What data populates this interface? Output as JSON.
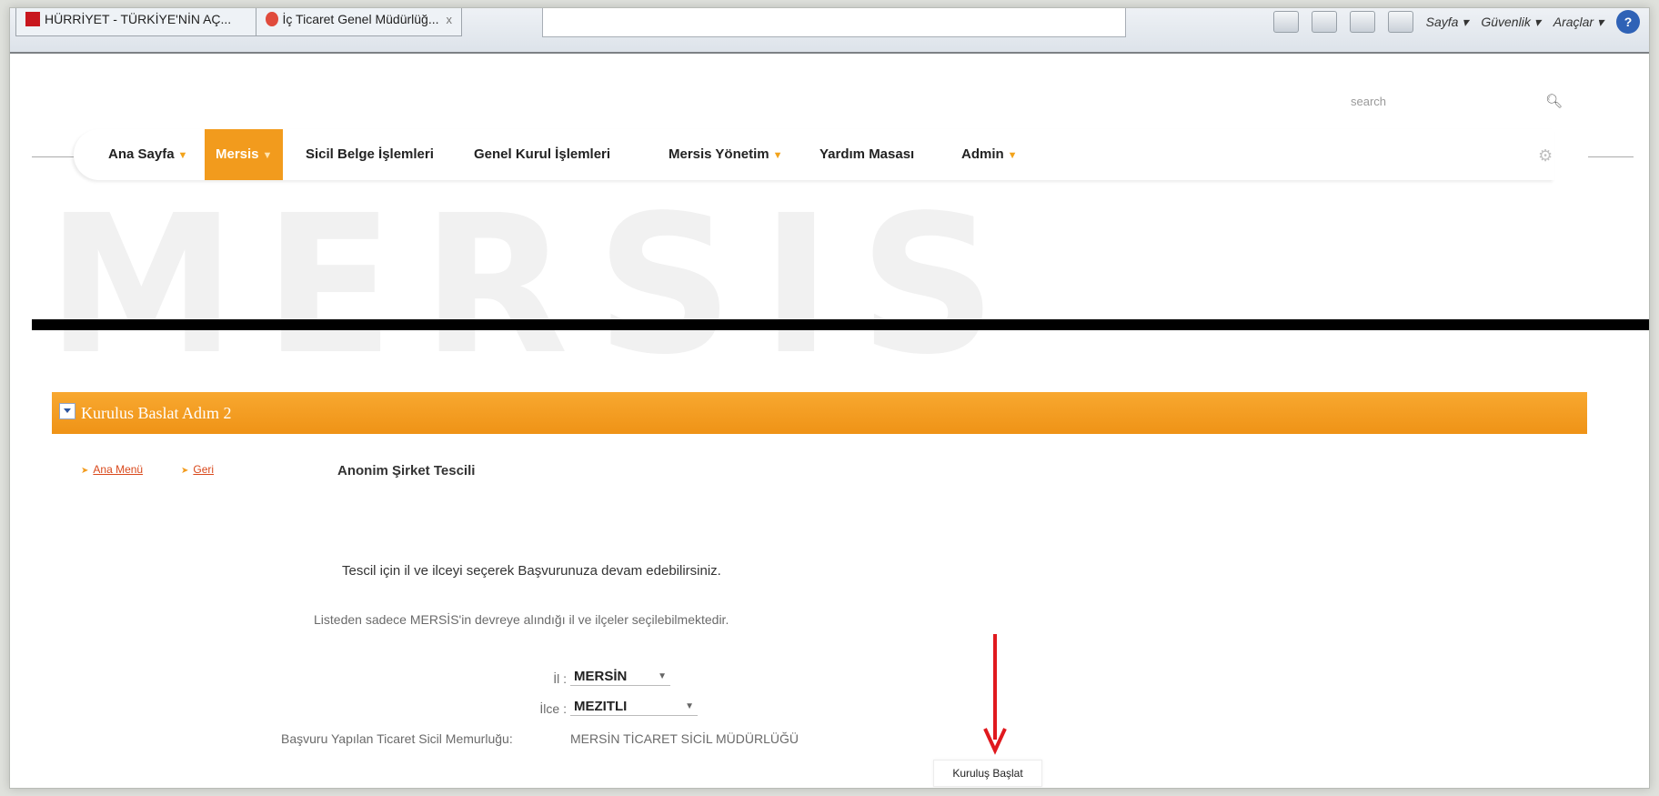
{
  "browser": {
    "tabs": [
      {
        "label": "HÜRRİYET - TÜRKİYE'NİN AÇ..."
      },
      {
        "label": "İç Ticaret Genel Müdürlüğ..."
      }
    ],
    "tools": [
      "Sayfa ▾",
      "Güvenlik ▾",
      "Araçlar ▾"
    ],
    "help_glyph": "?",
    "close_glyph": "x"
  },
  "header": {
    "search_placeholder": "search",
    "watermark": "MERSIS"
  },
  "nav": {
    "items": [
      {
        "label": "Ana Sayfa",
        "dropdown": true
      },
      {
        "label": "Mersis",
        "dropdown": true,
        "active": true
      },
      {
        "label": "Sicil Belge İşlemleri"
      },
      {
        "label": "Genel Kurul İşlemleri"
      },
      {
        "label": "Mersis Yönetim",
        "dropdown": true
      },
      {
        "label": "Yardım Masası"
      },
      {
        "label": "Admin",
        "dropdown": true
      }
    ]
  },
  "panel": {
    "title": "Kurulus Baslat Adım 2"
  },
  "links": {
    "home": "Ana Menü",
    "back": "Geri"
  },
  "subtitle": "Anonim Şirket Tescili",
  "messages": {
    "line1": "Tescil için il ve ilceyi seçerek Başvurunuza devam edebilirsiniz.",
    "line2": "Listeden sadece MERSİS'in devreye alındığı il ve ilçeler seçilebilmektedir."
  },
  "form": {
    "il_label": "İl :",
    "il_value": "MERSİN",
    "ilce_label": "İlce :",
    "ilce_value": "MEZITLI",
    "registry_label": "Başvuru Yapılan Ticaret Sicil Memurluğu:",
    "registry_value": "MERSİN TİCARET SİCİL MÜDÜRLÜĞÜ"
  },
  "buttons": {
    "start": "Kuruluş Başlat"
  },
  "colors": {
    "accent": "#f29b1d",
    "annotation_arrow": "#e0191e"
  }
}
